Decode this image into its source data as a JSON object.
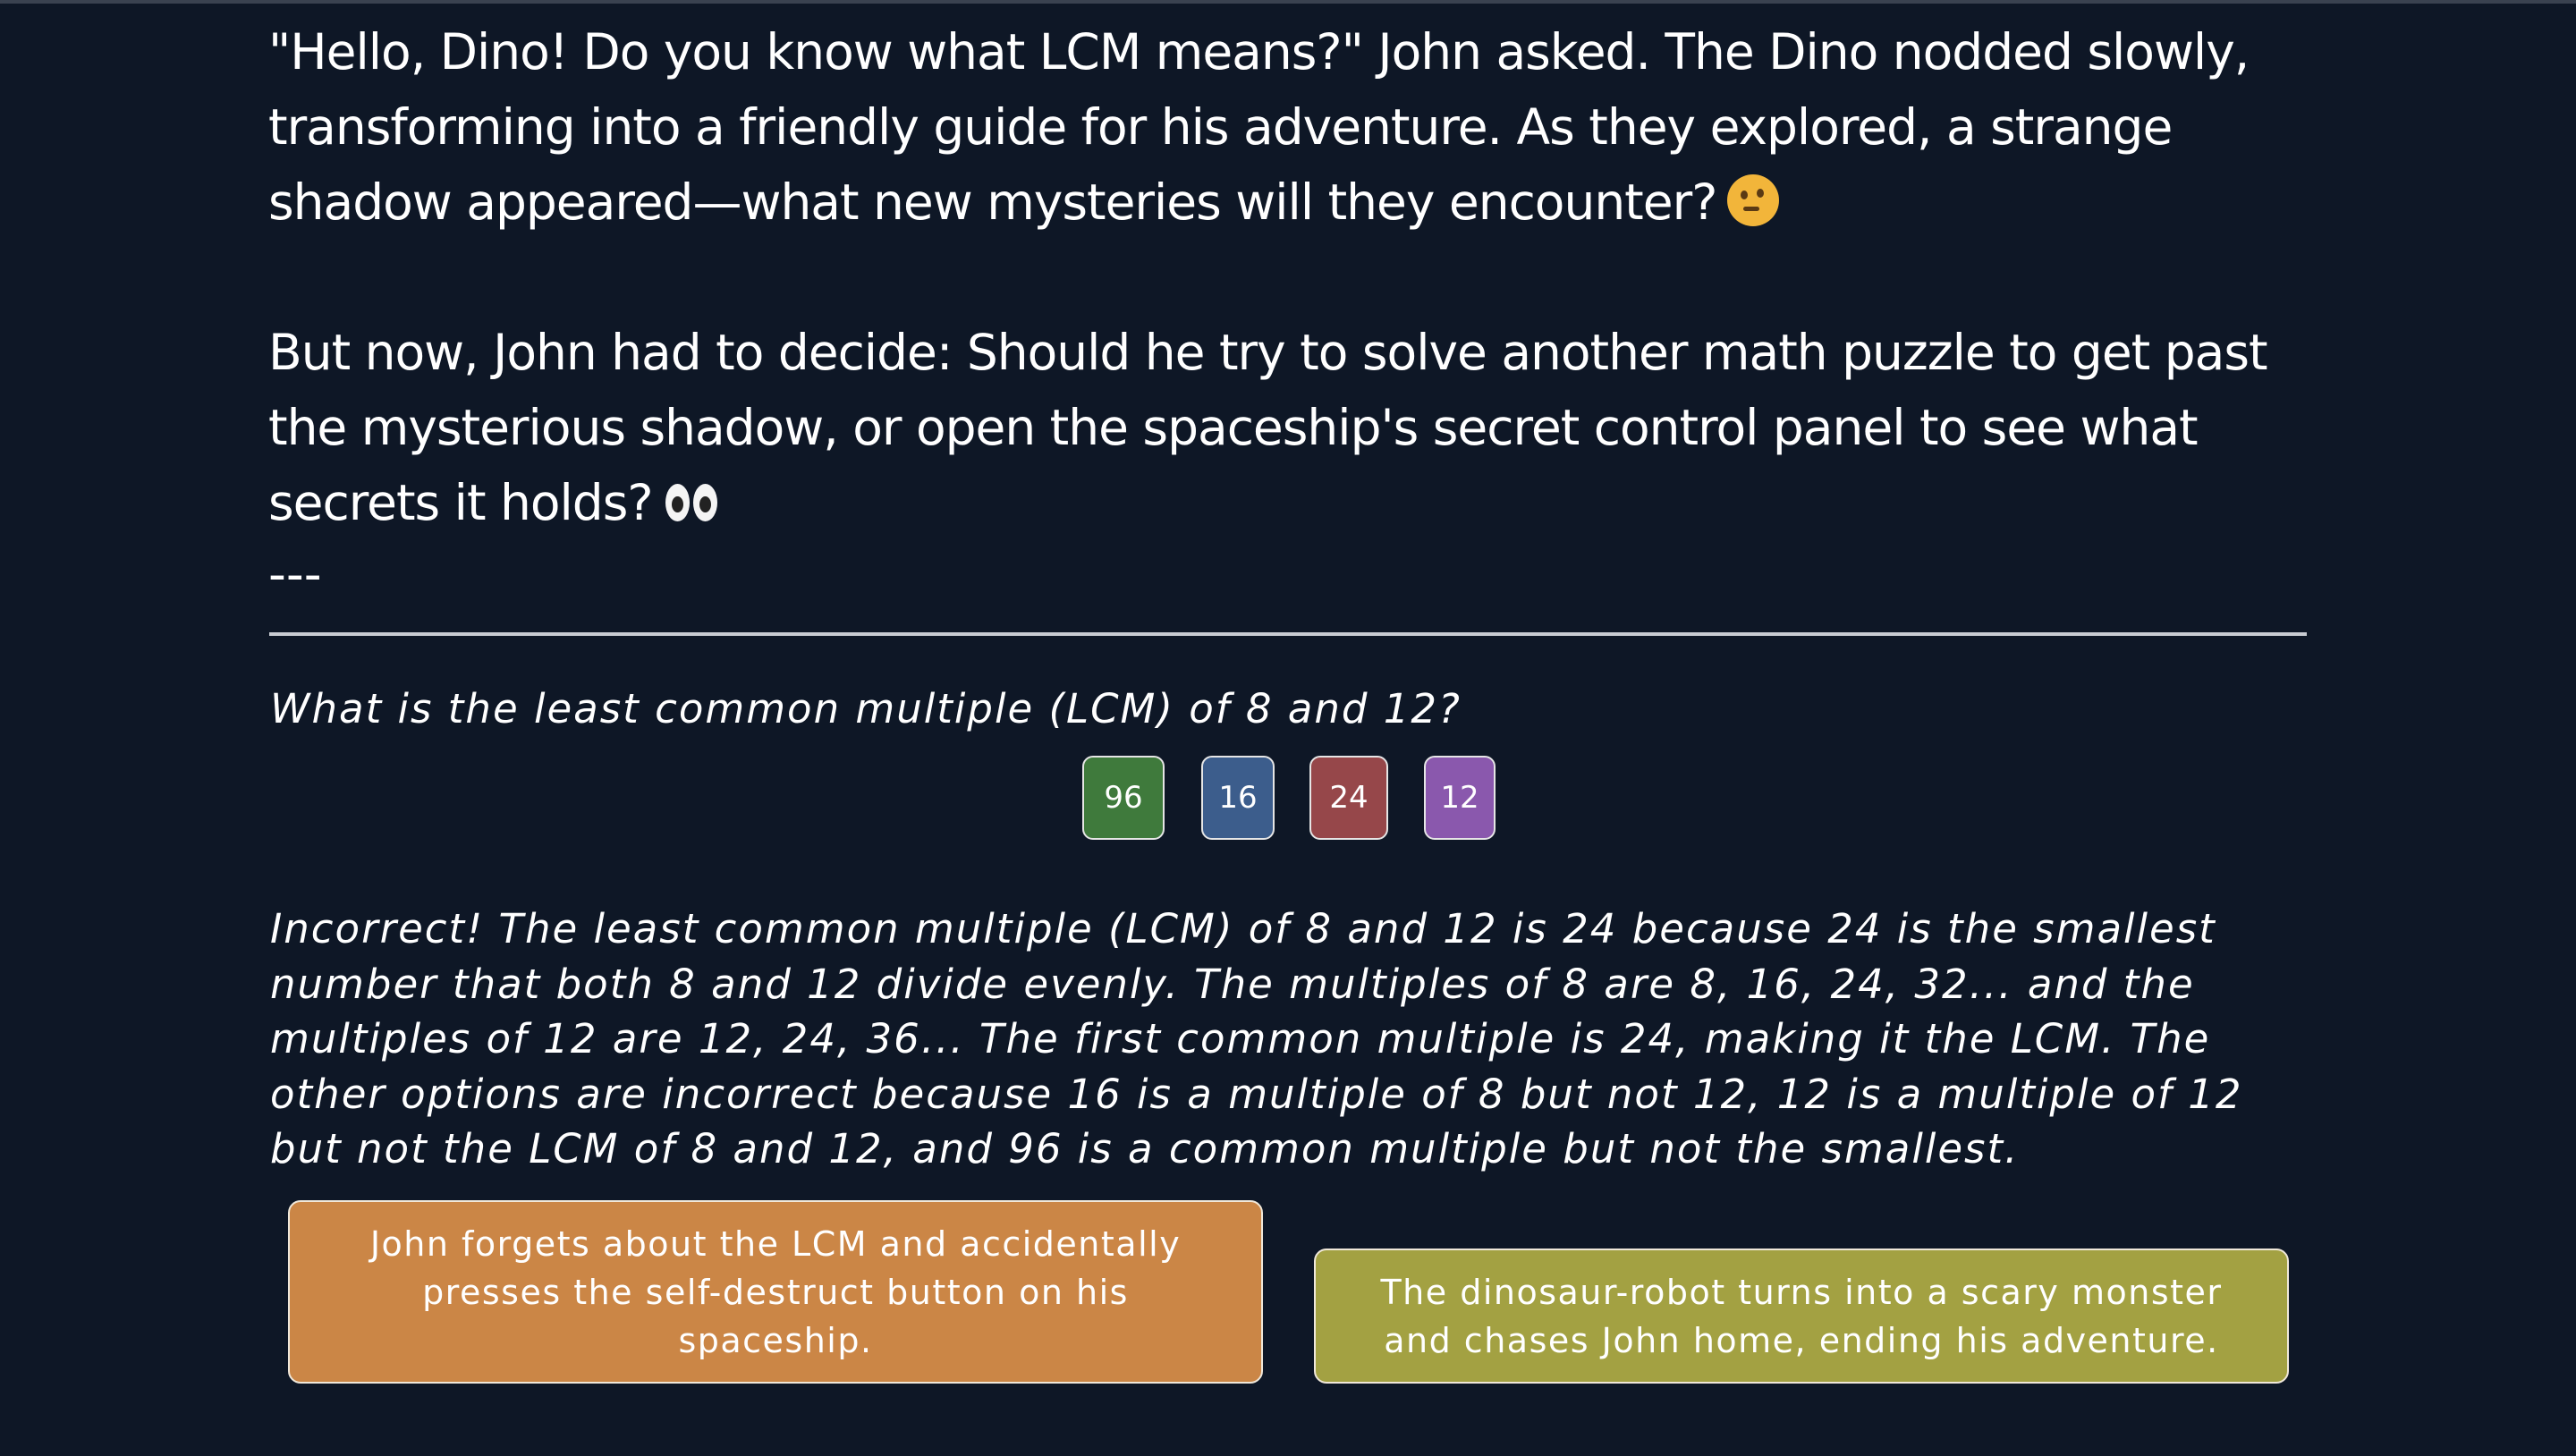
{
  "story": {
    "paragraph1": "\"Hello, Dino! Do you know what LCM means?\" John asked. The Dino nodded slowly, transforming into a friendly guide for his adventure. As they explored, a strange shadow appeared—what new mysteries will they encounter?",
    "paragraph1_emoji": "thinking-face-icon",
    "paragraph2": "But now, John had to decide: Should he try to solve another math puzzle to get past the mysterious shadow, or open the spaceship's secret control panel to see what secrets it holds?",
    "paragraph2_emoji": "eyes-icon",
    "separator": "---"
  },
  "quiz": {
    "question": "What is the least common multiple (LCM) of 8 and 12?",
    "answers": [
      {
        "label": "96",
        "color": "#3f7a3c"
      },
      {
        "label": "16",
        "color": "#3c5d8c"
      },
      {
        "label": "24",
        "color": "#96474a"
      },
      {
        "label": "12",
        "color": "#8a58ad"
      }
    ],
    "feedback": "Incorrect! The least common multiple (LCM) of 8 and 12 is 24 because 24 is the smallest number that both 8 and 12 divide evenly. The multiples of 8 are 8, 16, 24, 32... and the multiples of 12 are 12, 24, 36... The first common multiple is 24, making it the LCM. The other options are incorrect because 16 is a multiple of 8 but not 12, 12 is a multiple of 12 but not the LCM of 8 and 12, and 96 is a common multiple but not the smallest."
  },
  "choices": [
    {
      "label": "John forgets about the LCM and accidentally presses the self-destruct button on his spaceship.",
      "color": "#cb8646"
    },
    {
      "label": "The dinosaur-robot turns into a scary monster and chases John home, ending his adventure.",
      "color": "#a3a142"
    }
  ]
}
